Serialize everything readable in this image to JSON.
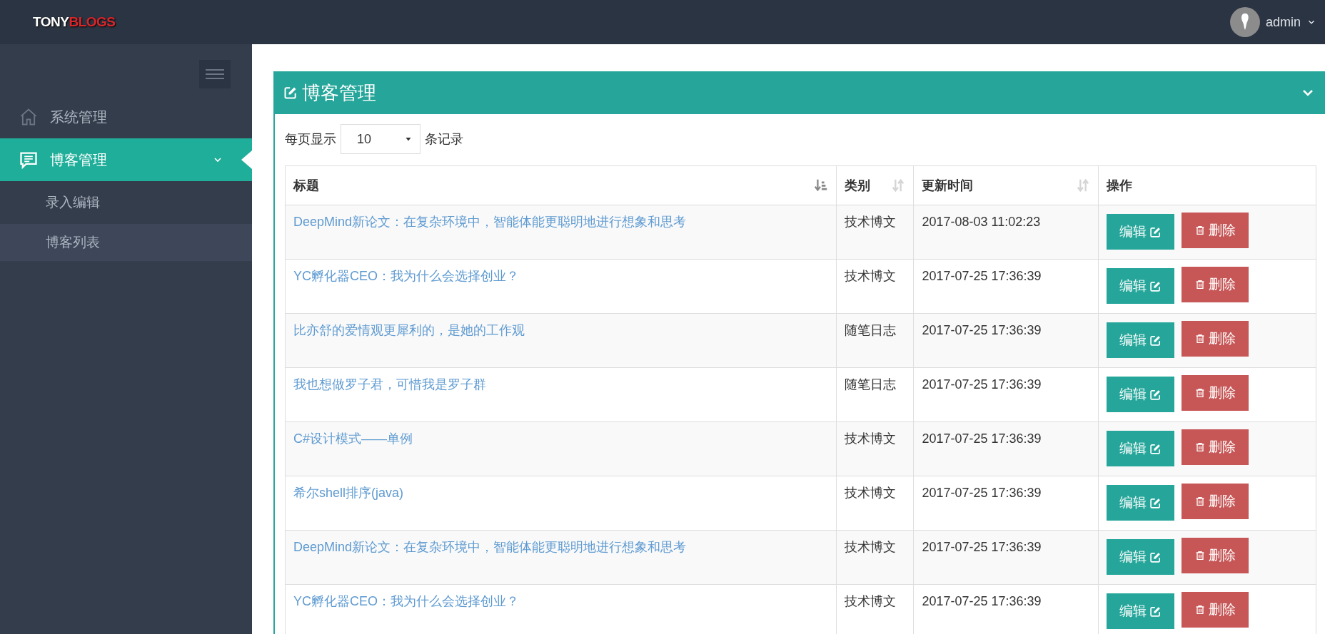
{
  "header": {
    "logo": {
      "text": "TONY",
      "accent": "BLOGS"
    },
    "user": {
      "name": "admin"
    }
  },
  "sidebar": {
    "items": [
      {
        "label": "系统管理",
        "kind": "home",
        "selected": false
      },
      {
        "label": "博客管理",
        "kind": "chat",
        "expanded": true,
        "selected": true,
        "children": [
          {
            "label": "录入编辑",
            "selected": false
          },
          {
            "label": "博客列表",
            "selected": true
          }
        ]
      }
    ]
  },
  "panel": {
    "title": "博客管理",
    "expanded": true,
    "page_size": {
      "prefix": "每页显示",
      "value": "10",
      "suffix": "条记录"
    },
    "table": {
      "columns": [
        {
          "label": "标题",
          "sortable": true,
          "sorted": true
        },
        {
          "label": "类别",
          "sortable": true,
          "sorted": false
        },
        {
          "label": "更新时间",
          "sortable": true,
          "sorted": false
        },
        {
          "label": "操作"
        }
      ],
      "rows": [
        {
          "title": "DeepMind新论文：在复杂环境中，智能体能更聪明地进行想象和思考",
          "category": "技术博文",
          "updated": "2017-08-03 11:02:23",
          "edit": "编辑",
          "delete": "删除"
        },
        {
          "title": "YC孵化器CEO：我为什么会选择创业？",
          "category": "技术博文",
          "updated": "2017-07-25 17:36:39",
          "edit": "编辑",
          "delete": "删除"
        },
        {
          "title": "比亦舒的爱情观更犀利的，是她的工作观",
          "category": "随笔日志",
          "updated": "2017-07-25 17:36:39",
          "edit": "编辑",
          "delete": "删除"
        },
        {
          "title": "我也想做罗子君，可惜我是罗子群",
          "category": "随笔日志",
          "updated": "2017-07-25 17:36:39",
          "edit": "编辑",
          "delete": "删除"
        },
        {
          "title": "C#设计模式——单例",
          "category": "技术博文",
          "updated": "2017-07-25 17:36:39",
          "edit": "编辑",
          "delete": "删除"
        },
        {
          "title": "希尔shell排序(java)",
          "category": "技术博文",
          "updated": "2017-07-25 17:36:39",
          "edit": "编辑",
          "delete": "删除"
        },
        {
          "title": "DeepMind新论文：在复杂环境中，智能体能更聪明地进行想象和思考",
          "category": "技术博文",
          "updated": "2017-07-25 17:36:39",
          "edit": "编辑",
          "delete": "删除"
        },
        {
          "title": "YC孵化器CEO：我为什么会选择创业？",
          "category": "技术博文",
          "updated": "2017-07-25 17:36:39",
          "edit": "编辑",
          "delete": "删除"
        }
      ]
    }
  }
}
